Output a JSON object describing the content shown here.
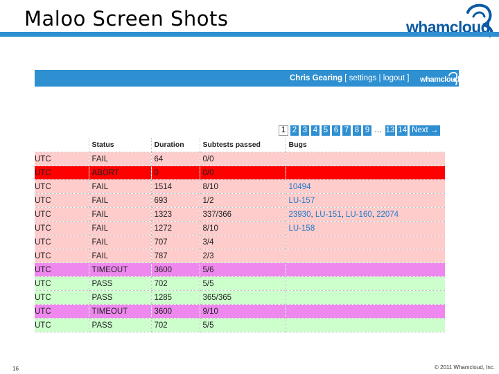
{
  "slide": {
    "title": "Maloo Screen Shots",
    "logo_text": "whamcloud",
    "page_number": "16",
    "copyright": "© 2011 Whamcloud, Inc."
  },
  "app": {
    "user": "Chris Gearing",
    "settings_label": "settings",
    "logout_label": "logout",
    "logo_text": "whamcloud"
  },
  "pagination": {
    "current": "1",
    "pages": [
      "2",
      "3",
      "4",
      "5",
      "6",
      "7",
      "8",
      "9"
    ],
    "ellipsis": "…",
    "last_pages": [
      "13",
      "14"
    ],
    "next_label": "Next →"
  },
  "table": {
    "headers": [
      "",
      "Status",
      "Duration",
      "Subtests passed",
      "Bugs"
    ],
    "rows": [
      {
        "status_class": "fail",
        "c0": "UTC",
        "status": "FAIL",
        "duration": "64",
        "subtests": "0/0",
        "bugs": []
      },
      {
        "status_class": "abort",
        "c0": "UTC",
        "status": "ABORT",
        "duration": "0",
        "subtests": "0/0",
        "bugs": []
      },
      {
        "status_class": "fail",
        "c0": "UTC",
        "status": "FAIL",
        "duration": "1514",
        "subtests": "8/10",
        "bugs": [
          "10494"
        ]
      },
      {
        "status_class": "fail",
        "c0": "UTC",
        "status": "FAIL",
        "duration": "693",
        "subtests": "1/2",
        "bugs": [
          "LU-157"
        ]
      },
      {
        "status_class": "fail",
        "c0": "UTC",
        "status": "FAIL",
        "duration": "1323",
        "subtests": "337/366",
        "bugs": [
          "23930",
          "LU-151",
          "LU-160",
          "22074"
        ]
      },
      {
        "status_class": "fail",
        "c0": "UTC",
        "status": "FAIL",
        "duration": "1272",
        "subtests": "8/10",
        "bugs": [
          "LU-158"
        ]
      },
      {
        "status_class": "fail",
        "c0": "UTC",
        "status": "FAIL",
        "duration": "707",
        "subtests": "3/4",
        "bugs": []
      },
      {
        "status_class": "fail",
        "c0": "UTC",
        "status": "FAIL",
        "duration": "787",
        "subtests": "2/3",
        "bugs": []
      },
      {
        "status_class": "timeout",
        "c0": "UTC",
        "status": "TIMEOUT",
        "duration": "3600",
        "subtests": "5/6",
        "bugs": []
      },
      {
        "status_class": "pass",
        "c0": "UTC",
        "status": "PASS",
        "duration": "702",
        "subtests": "5/5",
        "bugs": []
      },
      {
        "status_class": "pass",
        "c0": "UTC",
        "status": "PASS",
        "duration": "1285",
        "subtests": "365/365",
        "bugs": []
      },
      {
        "status_class": "timeout",
        "c0": "UTC",
        "status": "TIMEOUT",
        "duration": "3600",
        "subtests": "9/10",
        "bugs": []
      },
      {
        "status_class": "pass",
        "c0": "UTC",
        "status": "PASS",
        "duration": "702",
        "subtests": "5/5",
        "bugs": []
      }
    ]
  },
  "colors": {
    "accent_blue": "#2e8fd1",
    "fail_row": "#ffcccc",
    "abort_row": "#ff0000",
    "timeout_row": "#ee88ee",
    "pass_row": "#ccffcc",
    "bug_link": "#1f78c8"
  }
}
